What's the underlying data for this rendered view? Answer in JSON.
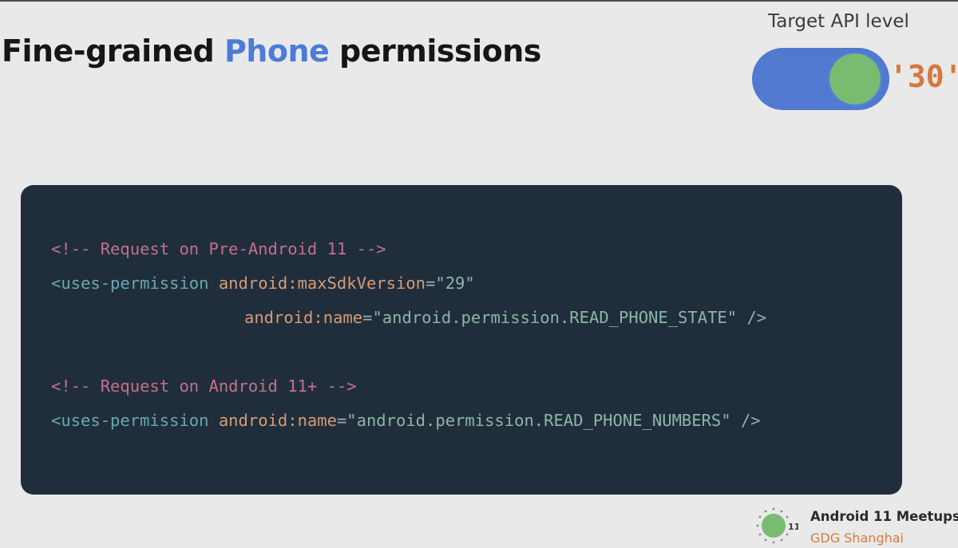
{
  "slide": {
    "title_prefix": "Fine-grained ",
    "title_highlight": "Phone",
    "title_suffix": " permissions",
    "accent_color": "#4d7bd6"
  },
  "api_toggle": {
    "label": "Target API level",
    "value": "'30'",
    "state": "on",
    "track_color": "#5079cf",
    "knob_color": "#79bb71"
  },
  "code": {
    "line1": "<!-- Request on Pre-Android 11 -->",
    "line2": {
      "tag": "<uses-permission",
      "attr": "android:maxSdkVersion",
      "eq": "=",
      "value": "\"29\""
    },
    "line3": {
      "attr": "android:name",
      "eq": "=",
      "value": "\"android.permission.READ_PHONE_STATE\"",
      "close": "/>"
    },
    "line4": "<!-- Request on Android 11+ -->",
    "line5": {
      "tag": "<uses-permission",
      "attr": "android:name",
      "eq": "=",
      "value": "\"android.permission.READ_PHONE_NUMBERS\"",
      "close": "/>"
    },
    "background": "#202e3c"
  },
  "footer": {
    "badge_number": "11",
    "title": "Android 11 Meetups",
    "subtitle": "GDG Shanghai",
    "subtitle_color": "#d77a3c",
    "icon": "android-11-badge-icon"
  }
}
